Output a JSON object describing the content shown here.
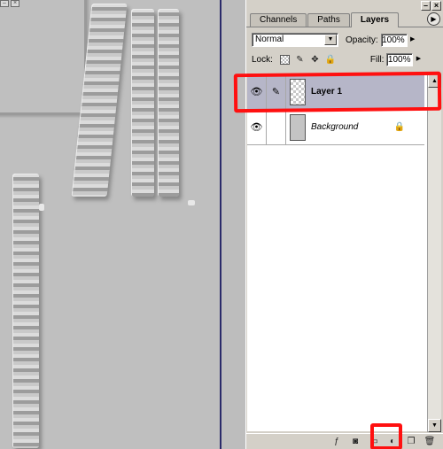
{
  "palette": {
    "tabs": [
      {
        "label": "Channels",
        "active": false
      },
      {
        "label": "Paths",
        "active": false
      },
      {
        "label": "Layers",
        "active": true
      }
    ],
    "blend_mode": "Normal",
    "opacity_label": "Opacity:",
    "opacity_value": "100%",
    "lock_label": "Lock:",
    "fill_label": "Fill:",
    "fill_value": "100%",
    "layers": [
      {
        "name": "Layer 1",
        "visible": true,
        "selected": true,
        "thumbnail": "transparent-checker"
      },
      {
        "name": "Background",
        "visible": true,
        "selected": false,
        "locked": true,
        "thumbnail": "gray"
      }
    ],
    "bottom_icons": [
      "layer-style-icon",
      "add-mask-icon",
      "new-set-icon",
      "adjustment-layer-icon",
      "new-layer-icon",
      "trash-icon"
    ]
  },
  "annotations": {
    "highlight_color": "#ff1010"
  }
}
